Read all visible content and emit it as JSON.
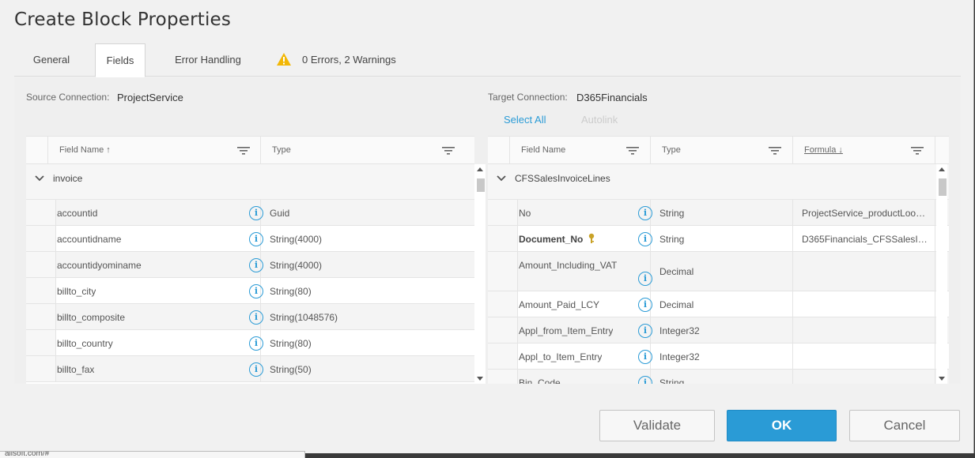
{
  "dialog": {
    "title": "Create Block Properties"
  },
  "tabs": [
    {
      "label": "General"
    },
    {
      "label": "Fields"
    },
    {
      "label": "Error Handling"
    }
  ],
  "validation_summary": "0 Errors, 2 Warnings",
  "source": {
    "connection_label": "Source Connection:",
    "connection_value": "ProjectService",
    "columns": [
      "Field Name ↑",
      "Type"
    ],
    "group": "invoice",
    "rows": [
      {
        "name": "accountid",
        "type": "Guid"
      },
      {
        "name": "accountidname",
        "type": "String(4000)"
      },
      {
        "name": "accountidyominame",
        "type": "String(4000)"
      },
      {
        "name": "billto_city",
        "type": "String(80)"
      },
      {
        "name": "billto_composite",
        "type": "String(1048576)"
      },
      {
        "name": "billto_country",
        "type": "String(80)"
      },
      {
        "name": "billto_fax",
        "type": "String(50)"
      }
    ]
  },
  "target": {
    "connection_label": "Target Connection:",
    "connection_value": "D365Financials",
    "select_all": "Select All",
    "autolink": "Autolink",
    "columns": [
      "Field Name",
      "Type",
      "Formula ↓"
    ],
    "group": "CFSSalesInvoiceLines",
    "rows": [
      {
        "name": "No",
        "type": "String",
        "formula": "ProjectService_productLook..."
      },
      {
        "name": "Document_No",
        "type": "String",
        "formula": "D365Financials_CFSSalesIn..."
      },
      {
        "name": "Amount_Including_VAT",
        "type": "Decimal",
        "formula": ""
      },
      {
        "name": "Amount_Paid_LCY",
        "type": "Decimal",
        "formula": ""
      },
      {
        "name": "Appl_from_Item_Entry",
        "type": "Integer32",
        "formula": ""
      },
      {
        "name": "Appl_to_Item_Entry",
        "type": "Integer32",
        "formula": ""
      },
      {
        "name": "Bin_Code",
        "type": "String",
        "formula": ""
      }
    ]
  },
  "info_glyph": "i",
  "buttons": {
    "validate": "Validate",
    "ok": "OK",
    "cancel": "Cancel"
  },
  "status_bar": "ailsoft.com/#",
  "colors": {
    "accent": "#2a9bd6",
    "warning": "#f2b705",
    "key": "#c9a227"
  },
  "icons": [
    "warning-icon",
    "chevron-down-icon",
    "filter-icon",
    "info-icon",
    "key-icon",
    "scroll-up-icon",
    "scroll-down-icon"
  ]
}
